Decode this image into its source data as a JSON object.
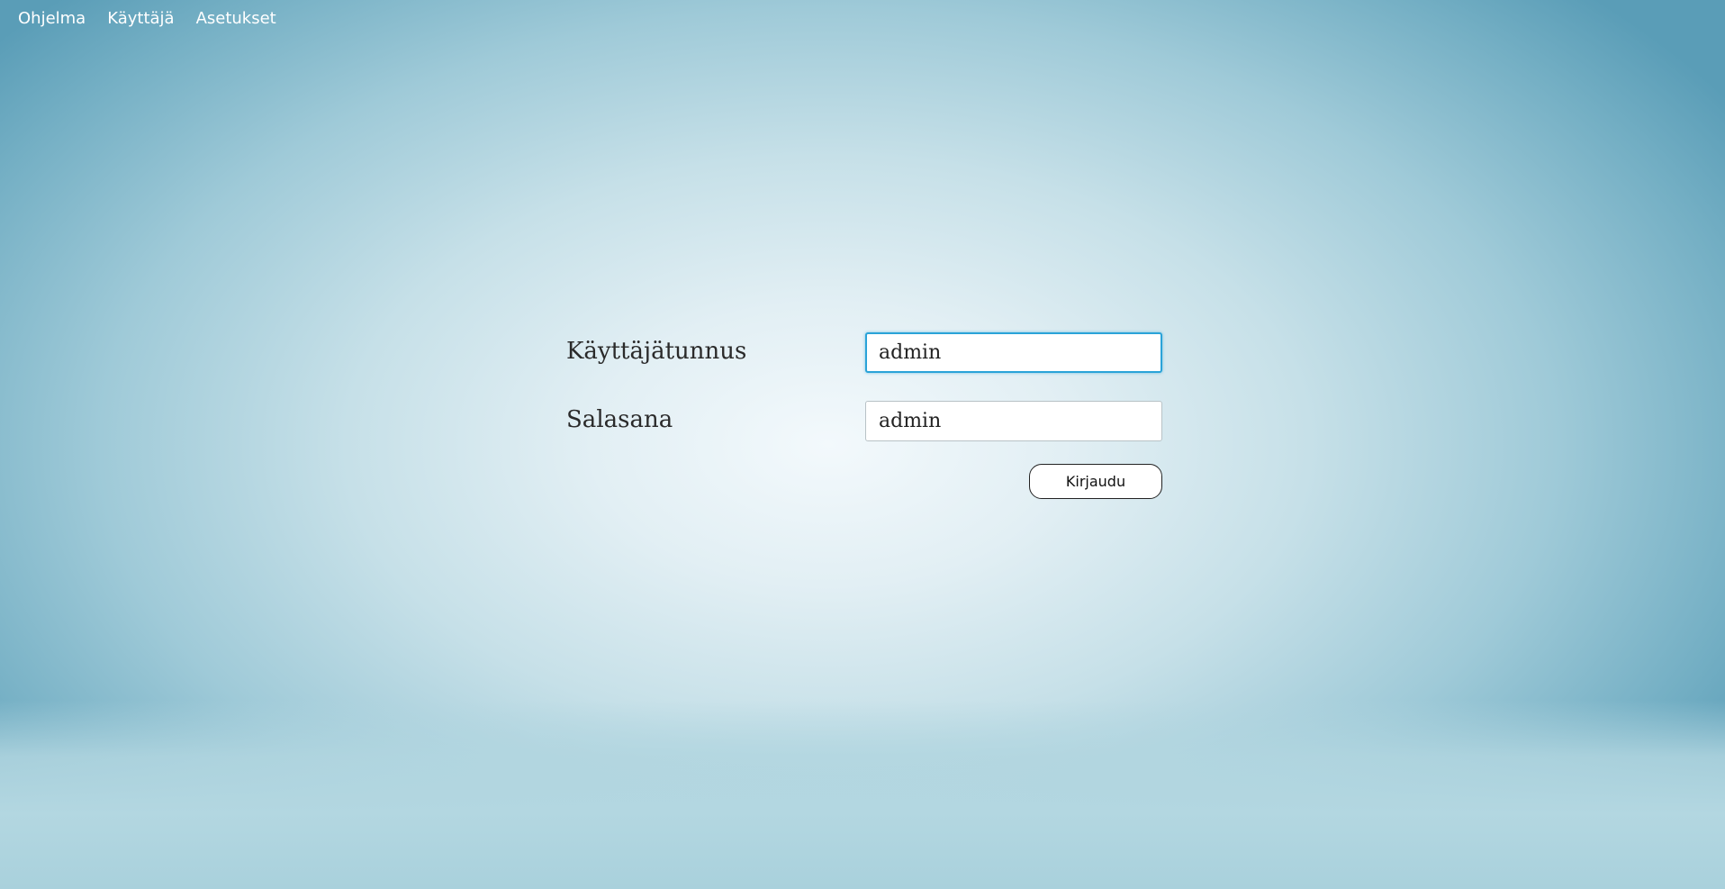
{
  "menu": {
    "items": [
      {
        "label": "Ohjelma"
      },
      {
        "label": "Käyttäjä"
      },
      {
        "label": "Asetukset"
      }
    ]
  },
  "login": {
    "username_label": "Käyttäjätunnus",
    "username_value": "admin",
    "password_label": "Salasana",
    "password_value": "admin",
    "submit_label": "Kirjaudu"
  },
  "colors": {
    "background_center": "#f3f9fc",
    "background_edge": "#5a9db7",
    "focus_border": "#2aa3d8",
    "menu_text": "#ffffff"
  }
}
